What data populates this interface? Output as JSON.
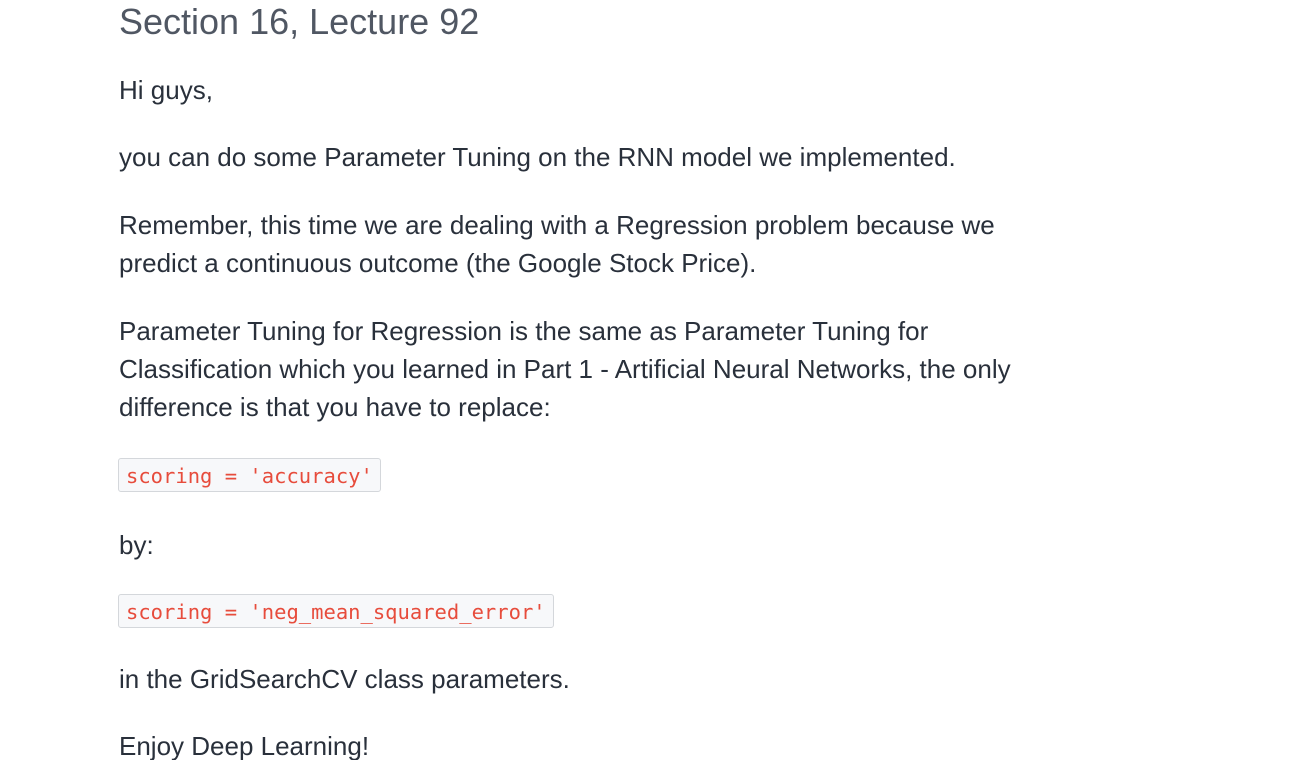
{
  "lecture": {
    "title": "Section 16, Lecture 92",
    "greeting": "Hi guys,",
    "intro": "you can do some Parameter Tuning on the RNN model we implemented.",
    "regression_line1": "Remember, this time we are dealing with a Regression problem because we",
    "regression_line2": "predict a continuous outcome (the Google Stock Price).",
    "tuning_line1": "Parameter Tuning for Regression is the same as Parameter Tuning for",
    "tuning_line2": "Classification which you learned in Part 1 - Artificial Neural Networks, the only",
    "tuning_line3": "difference is that you have to replace:",
    "code_old": "scoring = 'accuracy'",
    "by_text": "by:",
    "code_new": "scoring = 'neg_mean_squared_error'",
    "gridsearch_text": "in the GridSearchCV class parameters.",
    "closing": "Enjoy Deep Learning!"
  },
  "colors": {
    "text": "#29303b",
    "title": "#505763",
    "code_text": "#e74c3c",
    "code_bg": "#f7f8fa",
    "code_border": "#d4d7db"
  }
}
